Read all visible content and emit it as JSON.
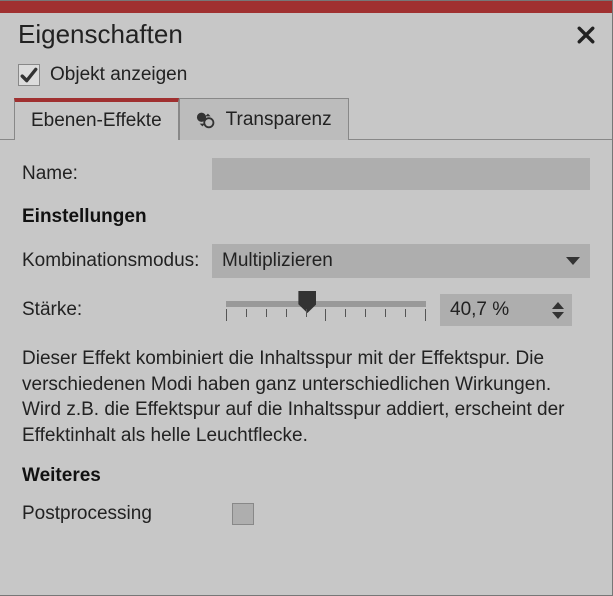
{
  "header": {
    "title": "Eigenschaften"
  },
  "showObject": {
    "label": "Objekt anzeigen",
    "checked": true
  },
  "tabs": {
    "layerEffects": "Ebenen-Effekte",
    "transparency": "Transparenz"
  },
  "fields": {
    "nameLabel": "Name:",
    "nameValue": ""
  },
  "sections": {
    "settings": "Einstellungen",
    "more": "Weiteres"
  },
  "blend": {
    "label": "Kombinationsmodus:",
    "value": "Multiplizieren"
  },
  "strength": {
    "label": "Stärke:",
    "value": "40,7 %",
    "percent": 40.7
  },
  "description": "Dieser Effekt kombiniert die Inhaltsspur mit der Effektspur. Die verschiedenen Modi haben ganz unterschiedlichen Wirkungen. Wird z.B. die Effektspur auf die Inhaltsspur addiert, erscheint der Effektinhalt als helle Leuchtflecke.",
  "postprocessing": {
    "label": "Postprocessing",
    "checked": false
  }
}
